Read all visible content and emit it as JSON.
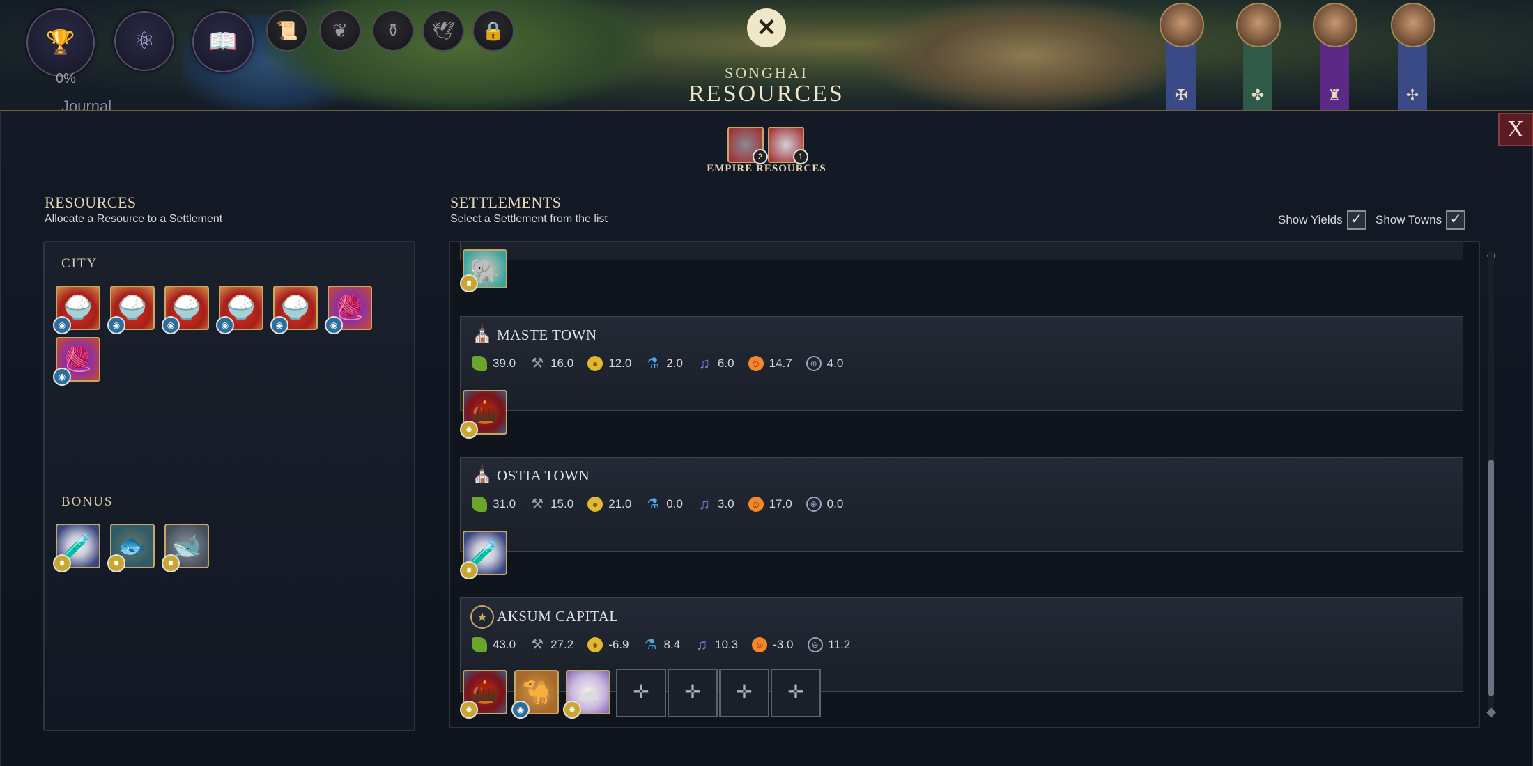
{
  "hud": {
    "progress_pct": "0%",
    "journal_label": "Journal",
    "civ_name": "SONGHAI",
    "screen_title": "RESOURCES"
  },
  "leaders": [
    {
      "banner_color": "#3a4a86",
      "symbol": "✠"
    },
    {
      "banner_color": "#2f5a4a",
      "symbol": "✤"
    },
    {
      "banner_color": "#5a2a86",
      "symbol": "♜"
    },
    {
      "banner_color": "#3a4a86",
      "symbol": "✢"
    }
  ],
  "close_label": "X",
  "empire_resources": {
    "label": "EMPIRE RESOURCES",
    "items": [
      {
        "icon": "cannon-icon",
        "count": "2"
      },
      {
        "icon": "helmet-icon",
        "count": "1"
      }
    ]
  },
  "resources_panel": {
    "title": "RESOURCES",
    "subtitle": "Allocate a Resource to a Settlement",
    "city_label": "CITY",
    "bonus_label": "BONUS",
    "city_items": [
      "sugar",
      "sugar",
      "sugar",
      "sugar",
      "sugar",
      "silk",
      "silk"
    ],
    "bonus_items": [
      "dyes",
      "fish",
      "whales"
    ]
  },
  "settlements_panel": {
    "title": "SETTLEMENTS",
    "subtitle": "Select a Settlement from the list",
    "show_yields_label": "Show Yields",
    "show_towns_label": "Show Towns",
    "show_yields_checked": true,
    "show_towns_checked": true
  },
  "settlements": [
    {
      "name": "MASTE TOWN",
      "type": "town",
      "yields": [
        "39.0",
        "16.0",
        "12.0",
        "2.0",
        "6.0",
        "14.7",
        "4.0"
      ],
      "resources": [
        "dates"
      ]
    },
    {
      "name": "OSTIA TOWN",
      "type": "town",
      "yields": [
        "31.0",
        "15.0",
        "21.0",
        "0.0",
        "3.0",
        "17.0",
        "0.0"
      ],
      "resources": [
        "dyes"
      ]
    },
    {
      "name": "AKSUM CAPITAL",
      "type": "capital",
      "yields": [
        "43.0",
        "27.2",
        "-6.9",
        "8.4",
        "10.3",
        "-3.0",
        "11.2"
      ],
      "resources": [
        "dates",
        "camels",
        "cotton"
      ],
      "empty_slots": 4
    }
  ],
  "yield_icons": [
    "food-icon",
    "production-icon",
    "gold-icon",
    "science-icon",
    "culture-icon",
    "happiness-icon",
    "influence-icon"
  ],
  "colors": {
    "accent_gold": "#c6a862",
    "close_red": "#5a1c22",
    "panel_bg": "#0f141d"
  }
}
